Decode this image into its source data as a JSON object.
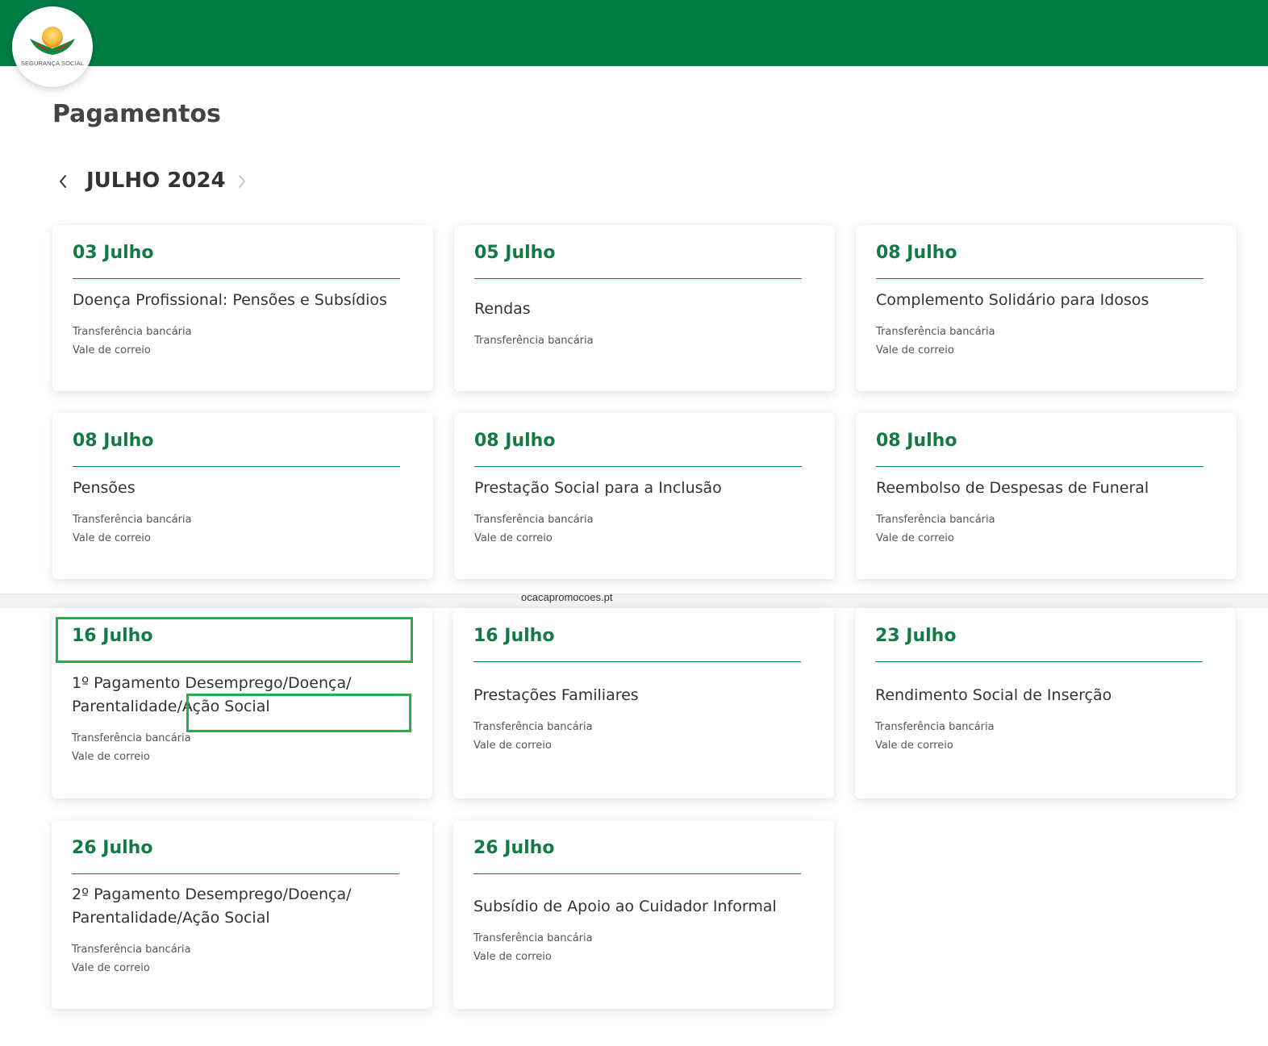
{
  "header": {
    "logo_text": "SEGURANÇA SOCIAL"
  },
  "page": {
    "title": "Pagamentos",
    "month_label": "JULHO 2024"
  },
  "watermark": "ocacapromocoes.pt",
  "payments": [
    {
      "date": "03 Julho",
      "benefit": "Doença Profissional: Pensões e Subsídios",
      "methods": [
        "Transferência bancária",
        "Vale de correio"
      ]
    },
    {
      "date": "05 Julho",
      "benefit": "Rendas",
      "methods": [
        "Transferência bancária"
      ]
    },
    {
      "date": "08 Julho",
      "benefit": "Complemento Solidário para Idosos",
      "methods": [
        "Transferência bancária",
        "Vale de correio"
      ]
    },
    {
      "date": "08 Julho",
      "benefit": "Pensões",
      "methods": [
        "Transferência bancária",
        "Vale de correio"
      ]
    },
    {
      "date": "08 Julho",
      "benefit": "Prestação Social para a Inclusão",
      "methods": [
        "Transferência bancária",
        "Vale de correio"
      ]
    },
    {
      "date": "08 Julho",
      "benefit": "Reembolso de Despesas de Funeral",
      "methods": [
        "Transferência bancária",
        "Vale de correio"
      ]
    },
    {
      "date": "16 Julho",
      "benefit": "1º Pagamento Desemprego/Doença/ Parentalidade/Ação Social",
      "methods": [
        "Transferência bancária",
        "Vale de correio"
      ]
    },
    {
      "date": "16 Julho",
      "benefit": "Prestações Familiares",
      "methods": [
        "Transferência bancária",
        "Vale de correio"
      ]
    },
    {
      "date": "23 Julho",
      "benefit": "Rendimento Social de Inserção",
      "methods": [
        "Transferência bancária",
        "Vale de correio"
      ]
    },
    {
      "date": "26 Julho",
      "benefit": "2º Pagamento Desemprego/Doença/ Parentalidade/Ação Social",
      "methods": [
        "Transferência bancária",
        "Vale de correio"
      ]
    },
    {
      "date": "26 Julho",
      "benefit": "Subsídio de Apoio ao Cuidador Informal",
      "methods": [
        "Transferência bancária",
        "Vale de correio"
      ]
    }
  ],
  "colors": {
    "brand_green": "#007e46",
    "date_green": "#137a44",
    "highlight_green": "#27ae4f"
  }
}
